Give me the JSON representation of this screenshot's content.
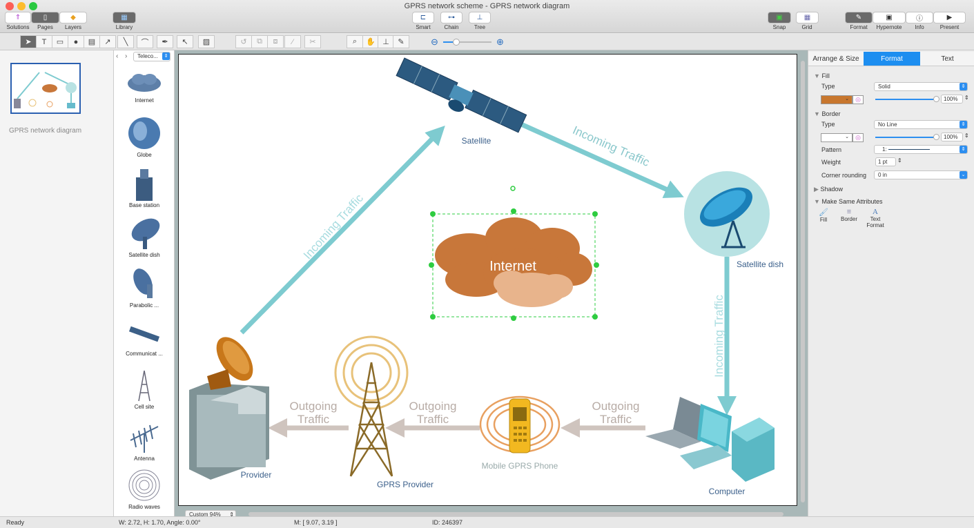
{
  "window": {
    "title": "GPRS network scheme - GPRS network diagram"
  },
  "toolbar_top": {
    "solutions": "Solutions",
    "pages": "Pages",
    "layers": "Layers",
    "library": "Library",
    "smart": "Smart",
    "chain": "Chain",
    "tree": "Tree",
    "snap": "Snap",
    "grid": "Grid",
    "format": "Format",
    "hypernote": "Hypernote",
    "info": "Info",
    "present": "Present"
  },
  "pages_panel": {
    "page_name": "GPRS network diagram"
  },
  "library": {
    "selector": "Teleco...",
    "items": [
      {
        "label": "Internet"
      },
      {
        "label": "Globe"
      },
      {
        "label": "Base station"
      },
      {
        "label": "Satellite dish"
      },
      {
        "label": "Parabolic ..."
      },
      {
        "label": "Communicat ..."
      },
      {
        "label": "Cell site"
      },
      {
        "label": "Antenna"
      },
      {
        "label": "Radio waves"
      }
    ]
  },
  "diagram": {
    "internet": "Internet",
    "satellite": "Satellite",
    "satellite_dish": "Satellite dish",
    "provider": "Provider",
    "gprs_provider": "GPRS Provider",
    "mobile_phone": "Mobile GPRS Phone",
    "computer": "Computer",
    "incoming1": "Incoming Traffic",
    "incoming2": "Incoming Traffic",
    "incoming3": "Incoming Traffic",
    "outgoing1": [
      "Outgoing",
      "Traffic"
    ],
    "outgoing2": [
      "Outgoing",
      "Traffic"
    ],
    "outgoing3": [
      "Outgoing",
      "Traffic"
    ],
    "colors": {
      "incoming": "#7ecbd0",
      "outgoing": "#cfc4be",
      "cloud": "#c8773a",
      "selection": "#2ecc40"
    }
  },
  "zoom": {
    "value": "Custom 94%"
  },
  "right_panel": {
    "tabs": [
      "Arrange & Size",
      "Format",
      "Text"
    ],
    "fill": {
      "header": "Fill",
      "type_label": "Type",
      "type_value": "Solid",
      "color": "#c8772e",
      "opacity": "100%"
    },
    "border": {
      "header": "Border",
      "type_label": "Type",
      "type_value": "No Line",
      "opacity": "100%",
      "pattern_label": "Pattern",
      "pattern_value": "1:",
      "weight_label": "Weight",
      "weight_value": "1 pt",
      "corner_label": "Corner rounding",
      "corner_value": "0 in"
    },
    "shadow": "Shadow",
    "make_same": {
      "header": "Make Same Attributes",
      "fill": "Fill",
      "border": "Border",
      "text_format": "Text Format"
    }
  },
  "status": {
    "ready": "Ready",
    "size": "W: 2.72,  H: 1.70,  Angle: 0.00°",
    "mouse": "M: [ 9.07, 3.19 ]",
    "id": "ID: 246397"
  }
}
